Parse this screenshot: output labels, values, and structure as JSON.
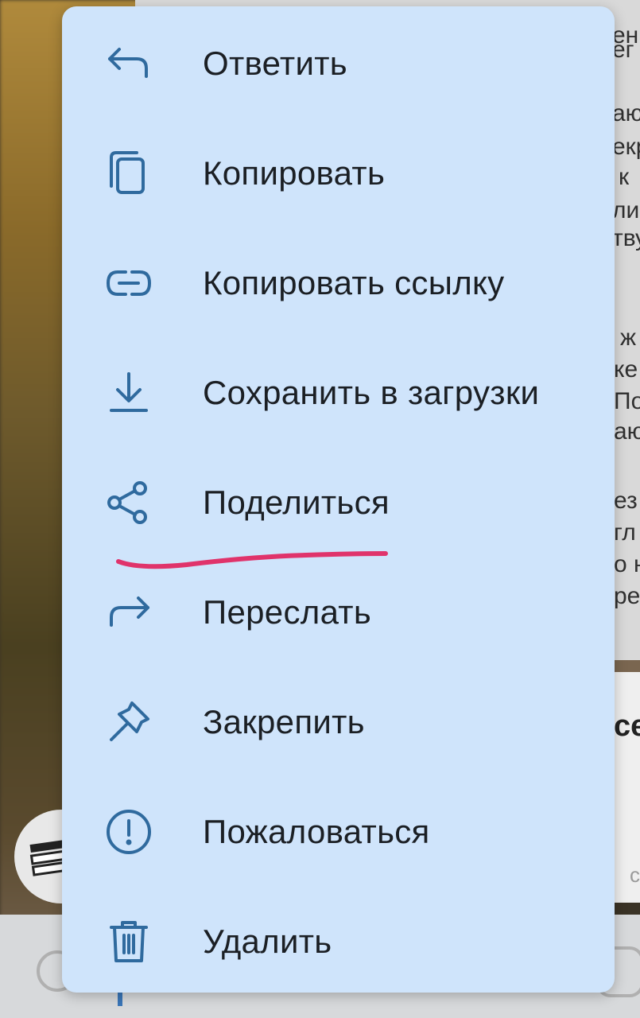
{
  "menu": {
    "items": [
      {
        "label": "Ответить",
        "icon": "reply-icon"
      },
      {
        "label": "Копировать",
        "icon": "copy-icon"
      },
      {
        "label": "Копировать ссылку",
        "icon": "link-icon"
      },
      {
        "label": "Сохранить в загрузки",
        "icon": "download-icon"
      },
      {
        "label": "Поделиться",
        "icon": "share-icon"
      },
      {
        "label": "Переслать",
        "icon": "forward-icon"
      },
      {
        "label": "Закрепить",
        "icon": "pin-icon"
      },
      {
        "label": "Пожаловаться",
        "icon": "report-icon"
      },
      {
        "label": "Удалить",
        "icon": "trash-icon"
      }
    ],
    "background": "#cfe4fb",
    "icon_color": "#2f6a9e",
    "annotation_color": "#e0336b"
  },
  "background_fragments": {
    "lines": [
      "ен",
      "ег",
      "аю",
      "екр",
      "к",
      "ли",
      "тву",
      "ж",
      "ке",
      "По",
      "аю",
      "ез",
      "гл",
      "о н",
      "ре"
    ],
    "card_text": "се",
    "card_small": "с"
  }
}
